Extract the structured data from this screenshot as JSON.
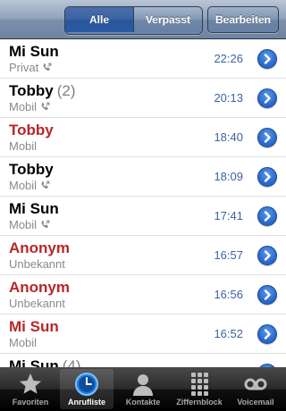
{
  "navbar": {
    "segments": [
      {
        "label": "Alle",
        "selected": true
      },
      {
        "label": "Verpasst",
        "selected": false
      }
    ],
    "edit_label": "Bearbeiten"
  },
  "calls": [
    {
      "name": "Mi Sun",
      "count": "",
      "type": "Privat",
      "time": "22:26",
      "missed": false,
      "icon": "phone-outgoing-icon"
    },
    {
      "name": "Tobby",
      "count": "(2)",
      "type": "Mobil",
      "time": "20:13",
      "missed": false,
      "icon": "phone-outgoing-icon"
    },
    {
      "name": "Tobby",
      "count": "",
      "type": "Mobil",
      "time": "18:40",
      "missed": true,
      "icon": ""
    },
    {
      "name": "Tobby",
      "count": "",
      "type": "Mobil",
      "time": "18:09",
      "missed": false,
      "icon": "phone-outgoing-icon"
    },
    {
      "name": "Mi Sun",
      "count": "",
      "type": "Mobil",
      "time": "17:41",
      "missed": false,
      "icon": "phone-outgoing-icon"
    },
    {
      "name": "Anonym",
      "count": "",
      "type": "Unbekannt",
      "time": "16:57",
      "missed": true,
      "icon": ""
    },
    {
      "name": "Anonym",
      "count": "",
      "type": "Unbekannt",
      "time": "16:56",
      "missed": true,
      "icon": ""
    },
    {
      "name": "Mi Sun",
      "count": "",
      "type": "Mobil",
      "time": "16:52",
      "missed": true,
      "icon": ""
    },
    {
      "name": "Mi Sun",
      "count": "(4)",
      "type": "",
      "time": "",
      "missed": false,
      "icon": ""
    }
  ],
  "tabbar": {
    "tabs": [
      {
        "label": "Favoriten",
        "icon": "star-icon",
        "active": false
      },
      {
        "label": "Anrufliste",
        "icon": "clock-icon",
        "active": true
      },
      {
        "label": "Kontakte",
        "icon": "person-icon",
        "active": false
      },
      {
        "label": "Ziffernblock",
        "icon": "keypad-icon",
        "active": false
      },
      {
        "label": "Voicemail",
        "icon": "voicemail-icon",
        "active": false
      }
    ]
  },
  "colors": {
    "missed": "#b8262b",
    "time": "#3b64a4",
    "accent": "#2f6fd1"
  }
}
